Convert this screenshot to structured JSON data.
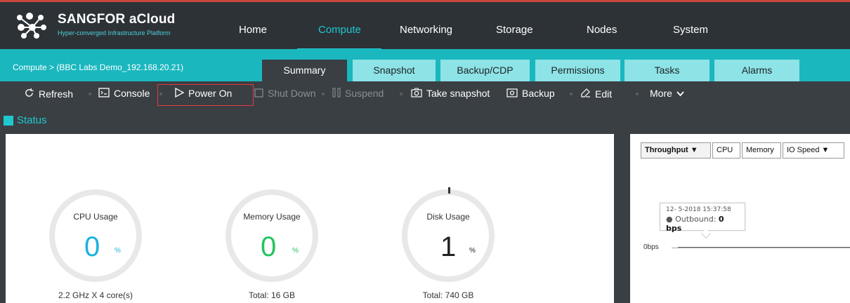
{
  "brand": {
    "name": "SANGFOR aCloud",
    "subtitle": "Hyper-converged Infrastructure Platform"
  },
  "nav": [
    {
      "label": "Home",
      "active": false
    },
    {
      "label": "Compute",
      "active": true
    },
    {
      "label": "Networking",
      "active": false
    },
    {
      "label": "Storage",
      "active": false
    },
    {
      "label": "Nodes",
      "active": false
    },
    {
      "label": "System",
      "active": false
    }
  ],
  "breadcrumb": "Compute > (BBC Labs Demo_192.168.20.21)",
  "tabs": [
    {
      "label": "Summary",
      "active": true
    },
    {
      "label": "Snapshot",
      "active": false
    },
    {
      "label": "Backup/CDP",
      "active": false
    },
    {
      "label": "Permissions",
      "active": false
    },
    {
      "label": "Tasks",
      "active": false
    },
    {
      "label": "Alarms",
      "active": false
    }
  ],
  "toolbar": {
    "refresh": "Refresh",
    "console": "Console",
    "power_on": "Power On",
    "shut_down": "Shut Down",
    "suspend": "Suspend",
    "take_snapshot": "Take snapshot",
    "backup": "Backup",
    "edit": "Edit",
    "more": "More"
  },
  "status": {
    "title": "Status"
  },
  "gauges": {
    "cpu": {
      "label": "CPU Usage",
      "value": "0",
      "unit": "%",
      "footer": "2.2 GHz X 4 core(s)",
      "color": "#1ab3dd"
    },
    "memory": {
      "label": "Memory Usage",
      "value": "0",
      "unit": "%",
      "footer": "Total: 16 GB",
      "color": "#22c55e"
    },
    "disk": {
      "label": "Disk Usage",
      "value": "1",
      "unit": "%",
      "footer": "Total: 740 GB",
      "color": "#222222"
    }
  },
  "chart_controls": {
    "throughput": "Throughput",
    "cpu": "CPU",
    "memory": "Memory",
    "io_speed": "IO Speed"
  },
  "chart_data": {
    "type": "line",
    "series": [
      {
        "name": "Outbound",
        "values": [
          0
        ]
      }
    ],
    "y_tick": "0bps",
    "tooltip": {
      "timestamp": "12- 5-2018 15:37:58",
      "series": "Outbound:",
      "value": "0 bps"
    }
  },
  "colors": {
    "accent": "#1fc8cf",
    "tab_bar": "#1ab7bf",
    "highlight": "#e03c3c"
  }
}
